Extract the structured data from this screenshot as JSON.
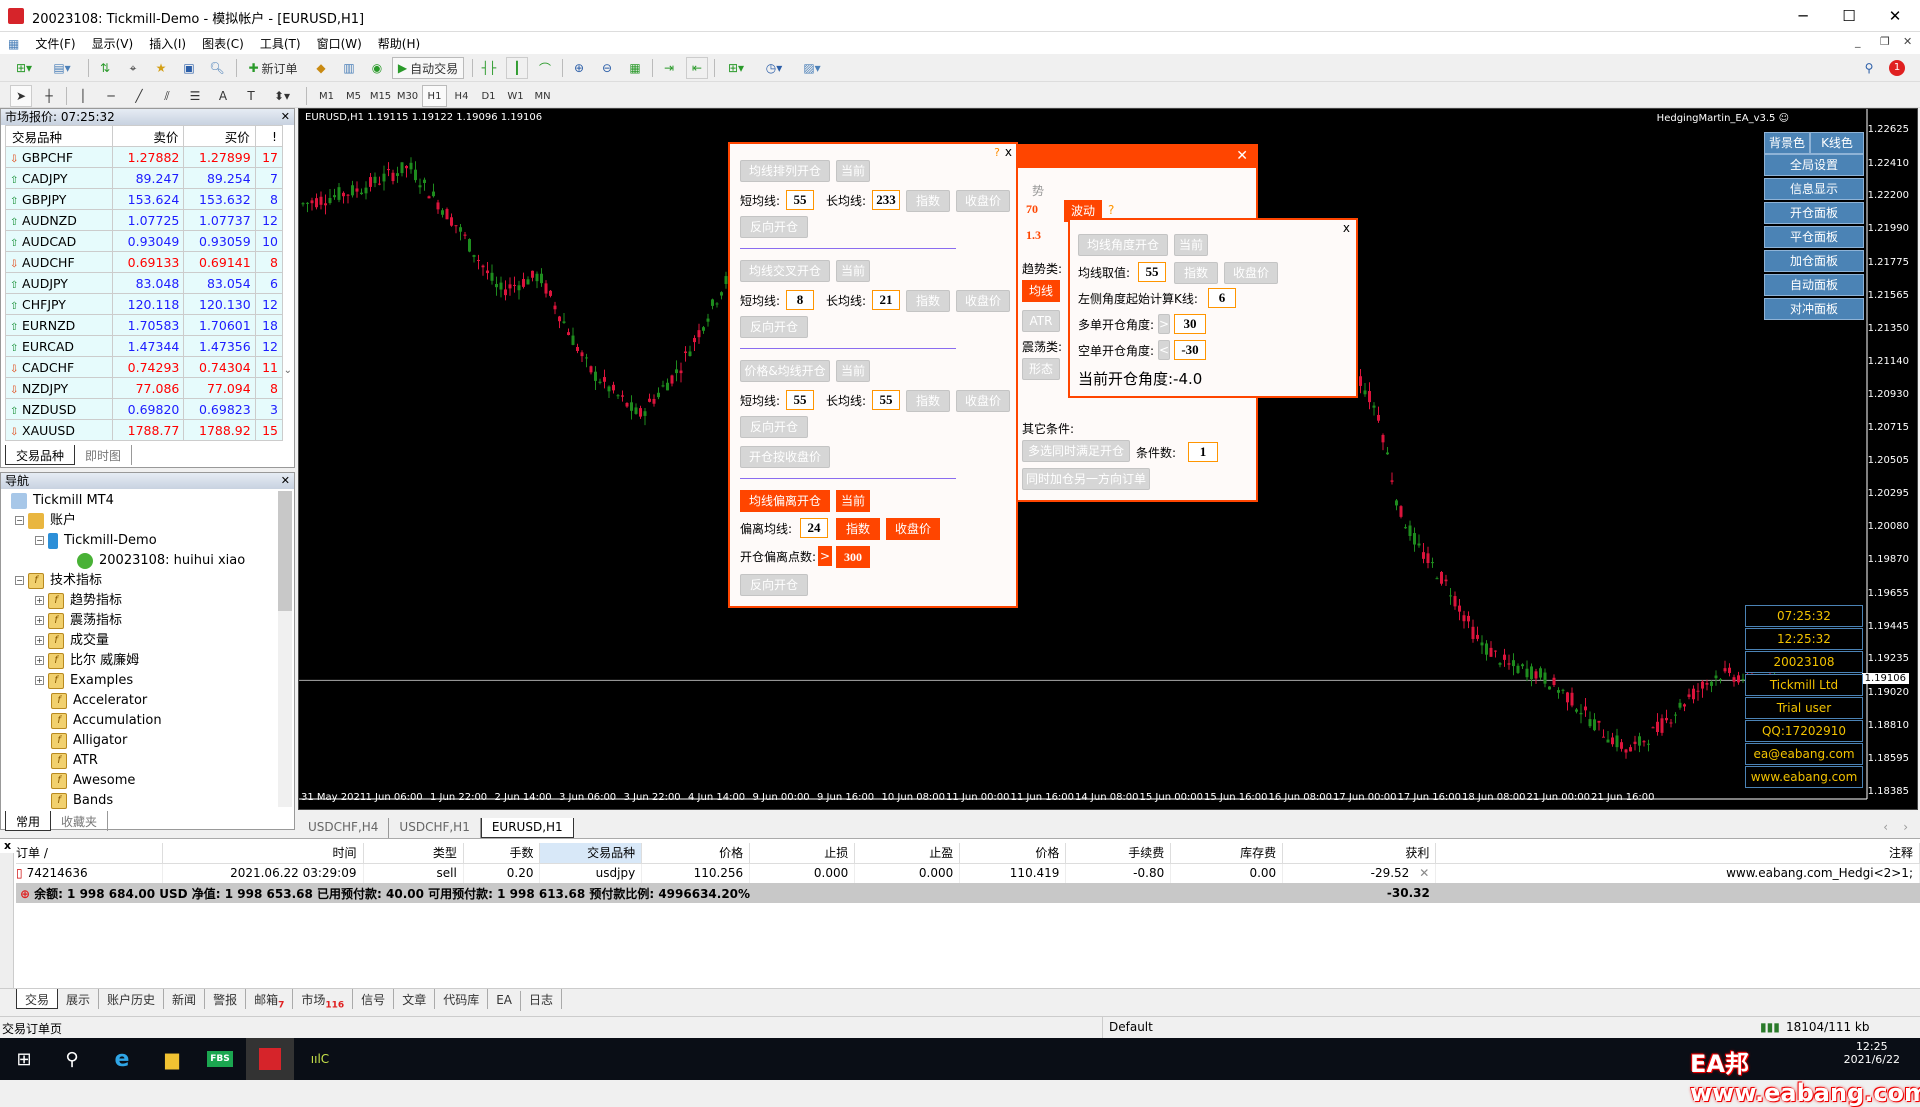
{
  "window": {
    "title": "20023108: Tickmill-Demo - 模拟帐户 - [EURUSD,H1]"
  },
  "menu": [
    "文件(F)",
    "显示(V)",
    "插入(I)",
    "图表(C)",
    "工具(T)",
    "窗口(W)",
    "帮助(H)"
  ],
  "toolbar": {
    "new_order": "新订单",
    "auto_trade": "自动交易"
  },
  "timeframes": [
    "M1",
    "M5",
    "M15",
    "M30",
    "H1",
    "H4",
    "D1",
    "W1",
    "MN"
  ],
  "active_timeframe": "H1",
  "market_watch": {
    "title": "市场报价: 07:25:32",
    "columns": [
      "交易品种",
      "卖价",
      "买价",
      "!"
    ],
    "rows": [
      {
        "symbol": "GBPCHF",
        "bid": "1.27882",
        "ask": "1.27899",
        "spread": "17",
        "dir": "down"
      },
      {
        "symbol": "CADJPY",
        "bid": "89.247",
        "ask": "89.254",
        "spread": "7",
        "dir": "up"
      },
      {
        "symbol": "GBPJPY",
        "bid": "153.624",
        "ask": "153.632",
        "spread": "8",
        "dir": "up"
      },
      {
        "symbol": "AUDNZD",
        "bid": "1.07725",
        "ask": "1.07737",
        "spread": "12",
        "dir": "up"
      },
      {
        "symbol": "AUDCAD",
        "bid": "0.93049",
        "ask": "0.93059",
        "spread": "10",
        "dir": "up"
      },
      {
        "symbol": "AUDCHF",
        "bid": "0.69133",
        "ask": "0.69141",
        "spread": "8",
        "dir": "down"
      },
      {
        "symbol": "AUDJPY",
        "bid": "83.048",
        "ask": "83.054",
        "spread": "6",
        "dir": "up"
      },
      {
        "symbol": "CHFJPY",
        "bid": "120.118",
        "ask": "120.130",
        "spread": "12",
        "dir": "up"
      },
      {
        "symbol": "EURNZD",
        "bid": "1.70583",
        "ask": "1.70601",
        "spread": "18",
        "dir": "up"
      },
      {
        "symbol": "EURCAD",
        "bid": "1.47344",
        "ask": "1.47356",
        "spread": "12",
        "dir": "up"
      },
      {
        "symbol": "CADCHF",
        "bid": "0.74293",
        "ask": "0.74304",
        "spread": "11",
        "dir": "down"
      },
      {
        "symbol": "NZDJPY",
        "bid": "77.086",
        "ask": "77.094",
        "spread": "8",
        "dir": "down"
      },
      {
        "symbol": "NZDUSD",
        "bid": "0.69820",
        "ask": "0.69823",
        "spread": "3",
        "dir": "up",
        "highlight": "green"
      },
      {
        "symbol": "XAUUSD",
        "bid": "1788.77",
        "ask": "1788.92",
        "spread": "15",
        "dir": "down",
        "highlight": "yellow"
      }
    ],
    "tabs": [
      "交易品种",
      "即时图"
    ]
  },
  "navigator": {
    "title": "导航",
    "items": {
      "root": "Tickmill MT4",
      "accounts": "账户",
      "server": "Tickmill-Demo",
      "user": "20023108: huihui xiao",
      "indicators": "技术指标",
      "groups": [
        "趋势指标",
        "震荡指标",
        "成交量",
        "比尔 威廉姆",
        "Examples"
      ],
      "list": [
        "Accelerator",
        "Accumulation",
        "Alligator",
        "ATR",
        "Awesome",
        "Bands"
      ]
    },
    "tabs": [
      "常用",
      "收藏夹"
    ]
  },
  "chart": {
    "info": "EURUSD,H1  1.19115 1.19122 1.19096 1.19106",
    "ea_label": "HedgingMartin_EA_v3.5 ☺",
    "current_price": "1.19106",
    "y_ticks": [
      "1.22625",
      "1.22410",
      "1.22200",
      "1.21990",
      "1.21775",
      "1.21565",
      "1.21350",
      "1.21140",
      "1.20930",
      "1.20715",
      "1.20505",
      "1.20295",
      "1.20080",
      "1.19870",
      "1.19655",
      "1.19445",
      "1.19235",
      "1.19020",
      "1.18810",
      "1.18595",
      "1.18385"
    ],
    "x_ticks": [
      "31 May 2021",
      "1 Jun 06:00",
      "1 Jun 22:00",
      "2 Jun 14:00",
      "3 Jun 06:00",
      "3 Jun 22:00",
      "4 Jun 14:00",
      "9 Jun 00:00",
      "9 Jun 16:00",
      "10 Jun 08:00",
      "11 Jun 00:00",
      "11 Jun 16:00",
      "14 Jun 08:00",
      "15 Jun 00:00",
      "15 Jun 16:00",
      "16 Jun 08:00",
      "17 Jun 00:00",
      "17 Jun 16:00",
      "18 Jun 08:00",
      "21 Jun 00:00",
      "21 Jun 16:00"
    ],
    "colors": {
      "bull": "#1e8c1e",
      "bear": "#dc143c"
    },
    "tabs": [
      "USDCHF,H4",
      "USDCHF,H1",
      "EURUSD,H1"
    ],
    "active_tab": "EURUSD,H1"
  },
  "side_panel": {
    "top": [
      "背景色",
      "K线色"
    ],
    "buttons": [
      "全局设置",
      "信息显示",
      "开仓面板",
      "平仓面板",
      "加仓面板",
      "自动面板",
      "对冲面板"
    ],
    "info": [
      "07:25:32",
      "12:25:32",
      "20023108",
      "Tickmill Ltd",
      "Trial user",
      "QQ:17202910",
      "ea@eabang.com",
      "www.eabang.com"
    ]
  },
  "open_panel": {
    "help": "?",
    "close": "x",
    "s1": {
      "btn": "均线排列开仓",
      "cur": "当前",
      "short_lbl": "短均线:",
      "short": "55",
      "long_lbl": "长均线:",
      "long": "233",
      "idx": "指数",
      "close_price": "收盘价",
      "reverse": "反向开仓"
    },
    "s2": {
      "btn": "均线交叉开仓",
      "cur": "当前",
      "short_lbl": "短均线:",
      "short": "8",
      "long_lbl": "长均线:",
      "long": "21",
      "idx": "指数",
      "close_price": "收盘价",
      "reverse": "反向开仓"
    },
    "s3": {
      "btn": "价格&均线开仓",
      "cur": "当前",
      "short_lbl": "短均线:",
      "short": "55",
      "long_lbl": "长均线:",
      "long": "55",
      "idx": "指数",
      "close_price": "收盘价",
      "reverse": "反向开仓",
      "by_close": "开仓按收盘价"
    },
    "s4": {
      "btn": "均线偏离开仓",
      "cur": "当前",
      "ma_lbl": "偏离均线:",
      "ma": "24",
      "idx": "指数",
      "close_price": "收盘价",
      "pts_lbl": "开仓偏离点数:",
      "gt": ">",
      "pts": "300",
      "reverse": "反向开仓"
    }
  },
  "filter_panel": {
    "close": "✕",
    "trend_hdr": "势",
    "v1": "70",
    "v2": "1.3",
    "wave": "波动",
    "q": "?",
    "trend_lbl": "趋势类:",
    "ma": "均线",
    "atr": "ATR",
    "osc_lbl": "震荡类:",
    "shape": "形态",
    "other_lbl": "其它条件:",
    "multi": "多选同时满足开仓",
    "cond_lbl": "条件数:",
    "cond": "1",
    "hedge": "同时加仓另一方向订单"
  },
  "angle_panel": {
    "close": "x",
    "btn": "均线角度开仓",
    "cur": "当前",
    "ma_lbl": "均线取值:",
    "ma": "55",
    "idx": "指数",
    "close_price": "收盘价",
    "k_lbl": "左侧角度起始计算K线:",
    "k": "6",
    "buy_lbl": "多单开仓角度:",
    "gt": ">",
    "buy": "30",
    "sell_lbl": "空单开仓角度:",
    "lt": "<",
    "sell": "-30",
    "current": "当前开仓角度:-4.0"
  },
  "terminal": {
    "columns": [
      "订单 /",
      "时间",
      "类型",
      "手数",
      "交易品种",
      "价格",
      "止损",
      "止盈",
      "价格",
      "手续费",
      "库存费",
      "获利",
      "注释"
    ],
    "order": [
      "74214636",
      "2021.06.22 03:29:09",
      "sell",
      "0.20",
      "usdjpy",
      "110.256",
      "0.000",
      "0.000",
      "110.419",
      "-0.80",
      "0.00",
      "-29.52",
      "www.eabang.com_Hedgi<2>1;"
    ],
    "summary": "余额: 1 998 684.00 USD  净值: 1 998 653.68  已用预付款: 40.00  可用预付款: 1 998 613.68  预付款比例: 4996634.20%",
    "total": "-30.32",
    "tabs": [
      {
        "label": "交易"
      },
      {
        "label": "展示"
      },
      {
        "label": "账户历史"
      },
      {
        "label": "新闻"
      },
      {
        "label": "警报"
      },
      {
        "label": "邮箱",
        "badge": "7"
      },
      {
        "label": "市场",
        "badge": "116"
      },
      {
        "label": "信号"
      },
      {
        "label": "文章"
      },
      {
        "label": "代码库"
      },
      {
        "label": "EA"
      },
      {
        "label": "日志"
      }
    ]
  },
  "status": {
    "left": "交易订单页",
    "profile": "Default",
    "traffic": "18104/111 kb"
  },
  "watermark": "EA邦www.eabang.com",
  "taskbar": {
    "time": "12:25",
    "date": "2021/6/22"
  }
}
